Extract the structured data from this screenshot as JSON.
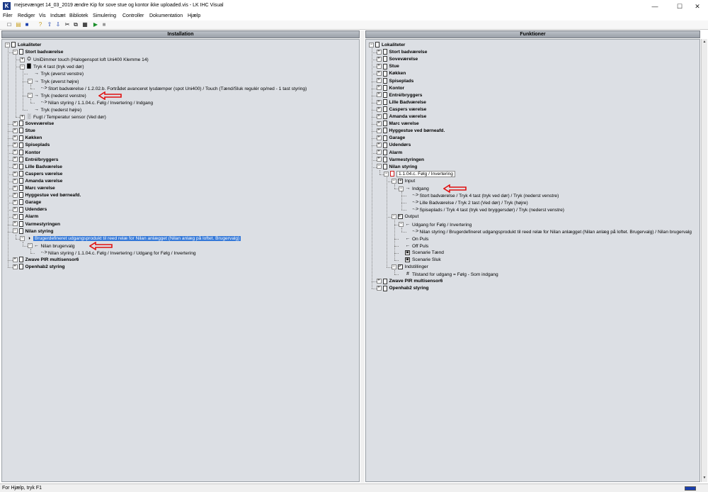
{
  "window": {
    "title": "mejsevænget 14_03_2019 ændre Kip for sove stue og kontor ikke uploaded.vis - LK IHC Visual",
    "controls": {
      "minimize": "—",
      "maximize": "☐",
      "close": "✕"
    }
  },
  "menu": [
    {
      "label": "Filer"
    },
    {
      "label": "Rediger"
    },
    {
      "label": "Vis"
    },
    {
      "label": "Indsæt"
    },
    {
      "label": "Bibliotek"
    },
    {
      "label": "Simulering"
    },
    {
      "label": "Controller"
    },
    {
      "label": "Dokumentation"
    },
    {
      "label": "Hjælp"
    }
  ],
  "toolbar": [
    "new-icon",
    "open-icon",
    "save-icon",
    "help-icon",
    "upload-icon",
    "download-icon",
    "cut-icon",
    "copy-icon",
    "paste-icon",
    "run-icon",
    "stop-icon"
  ],
  "left_pane": {
    "header": "Installation",
    "rows": [
      {
        "label": "Lokaliteter",
        "bold": true,
        "icon": "doc"
      },
      {
        "label": "Stort badværelse",
        "bold": true,
        "icon": "doc"
      },
      {
        "label": "UniDimmer touch (Halogenspot loft  Uni400 Klemme 14)",
        "icon": "dimmer"
      },
      {
        "label": "Tryk 4 tast (tryk ved dør)",
        "icon": "switch"
      },
      {
        "label": "Tryk (øverst venstre)",
        "icon": "arrow"
      },
      {
        "label": "Tryk (øverst højre)",
        "icon": "arrow"
      },
      {
        "label": "Stort badværelse / 1.2.02.b. Fortrådet avanceret lysdæmper (spot Uni400) / Touch (Tænd/Sluk regulér op/ned - 1 tast styring)",
        "icon": "link"
      },
      {
        "label": "Tryk (nederst venstre)",
        "icon": "arrow"
      },
      {
        "label": "Nilan styring / 1.1.04.c. Følg / Invertering  / Indgang",
        "icon": "link"
      },
      {
        "label": "Tryk (nederst højre)",
        "icon": "arrow"
      },
      {
        "label": "Fugt / Temperatur sensor (Ved dør)",
        "icon": "sensor"
      },
      {
        "label": "Soveværelse",
        "bold": true,
        "icon": "doc"
      },
      {
        "label": "Stue",
        "bold": true,
        "icon": "doc"
      },
      {
        "label": "Køkken",
        "bold": true,
        "icon": "doc"
      },
      {
        "label": "Spiseplads",
        "bold": true,
        "icon": "doc"
      },
      {
        "label": "Kontor",
        "bold": true,
        "icon": "doc"
      },
      {
        "label": "Entré/bryggers",
        "bold": true,
        "icon": "doc"
      },
      {
        "label": "Lille Badværelse",
        "bold": true,
        "icon": "doc"
      },
      {
        "label": "Caspers værelse",
        "bold": true,
        "icon": "doc"
      },
      {
        "label": "Amanda værelse",
        "bold": true,
        "icon": "doc"
      },
      {
        "label": "Marc værelse",
        "bold": true,
        "icon": "doc"
      },
      {
        "label": "Hyggestue ved børneafd.",
        "bold": true,
        "icon": "doc"
      },
      {
        "label": "Garage",
        "bold": true,
        "icon": "doc"
      },
      {
        "label": "Udendørs",
        "bold": true,
        "icon": "doc"
      },
      {
        "label": "Alarm",
        "bold": true,
        "icon": "doc"
      },
      {
        "label": "Varmestyringen",
        "bold": true,
        "icon": "doc"
      },
      {
        "label": "Nilan styring",
        "bold": true,
        "icon": "doc"
      },
      {
        "label": "Brugerdefineret udgangsprodukt til reed relæ for Nilan anlægget (Nilan anlæg på loftet. Brugervalg)",
        "icon": "relay",
        "selected": true
      },
      {
        "label": "Nilan brugervalg",
        "icon": "arrow-left"
      },
      {
        "label": "Nilan styring / 1.1.04.c. Følg / Invertering  / Udgang for Følg / Invertering",
        "icon": "link"
      },
      {
        "label": "Zwave PIR multisensor6",
        "bold": true,
        "icon": "doc"
      },
      {
        "label": "Openhab2 styring",
        "bold": true,
        "icon": "doc"
      }
    ]
  },
  "right_pane": {
    "header": "Funktioner",
    "rows": [
      {
        "label": "Lokaliteter",
        "bold": true,
        "icon": "doc"
      },
      {
        "label": "Stort badværelse",
        "bold": true,
        "icon": "doc"
      },
      {
        "label": "Soveværelse",
        "bold": true,
        "icon": "doc"
      },
      {
        "label": "Stue",
        "bold": true,
        "icon": "doc"
      },
      {
        "label": "Køkken",
        "bold": true,
        "icon": "doc"
      },
      {
        "label": "Spiseplads",
        "bold": true,
        "icon": "doc"
      },
      {
        "label": "Kontor",
        "bold": true,
        "icon": "doc"
      },
      {
        "label": "Entré/bryggers",
        "bold": true,
        "icon": "doc"
      },
      {
        "label": "Lille Badværelse",
        "bold": true,
        "icon": "doc"
      },
      {
        "label": "Caspers værelse",
        "bold": true,
        "icon": "doc"
      },
      {
        "label": "Amanda værelse",
        "bold": true,
        "icon": "doc"
      },
      {
        "label": "Marc værelse",
        "bold": true,
        "icon": "doc"
      },
      {
        "label": "Hyggestue ved børneafd.",
        "bold": true,
        "icon": "doc"
      },
      {
        "label": "Garage",
        "bold": true,
        "icon": "doc"
      },
      {
        "label": "Udendørs",
        "bold": true,
        "icon": "doc"
      },
      {
        "label": "Alarm",
        "bold": true,
        "icon": "doc"
      },
      {
        "label": "Varmestyringen",
        "bold": true,
        "icon": "doc"
      },
      {
        "label": "Nilan styring",
        "bold": true,
        "icon": "doc"
      },
      {
        "label": "1.1.04.c. Følg / Invertering",
        "icon": "func",
        "boxed": true
      },
      {
        "label": "Input",
        "icon": "input"
      },
      {
        "label": "Indgang",
        "icon": "arrow"
      },
      {
        "label": "Stort badværelse / Tryk 4 tast (tryk ved dør) / Tryk (nederst venstre)",
        "icon": "link"
      },
      {
        "label": "Lille Badværelse / Tryk 2 tast (Ved dør)  / Tryk (højre)",
        "icon": "link"
      },
      {
        "label": "Spiseplads / Tryk 4 tast (tryk ved bryggersdør)  / Tryk (nederst venstre)",
        "icon": "link"
      },
      {
        "label": "Output",
        "icon": "output"
      },
      {
        "label": "Udgang for Følg / Invertering",
        "icon": "arrow-left"
      },
      {
        "label": "Nilan styring / Brugerdefineret udgangsprodukt til reed relæ for Nilan anlægget (Nilan anlæg på loftet. Brugervalg)  / Nilan brugervalg",
        "icon": "link"
      },
      {
        "label": "On Puls",
        "icon": "arrow-left"
      },
      {
        "label": "Off Puls",
        "icon": "arrow-left"
      },
      {
        "label": "Scenarie Tænd",
        "icon": "scene"
      },
      {
        "label": "Scenarie Sluk",
        "icon": "scene"
      },
      {
        "label": "Indstillinger",
        "icon": "settings"
      },
      {
        "label": "Tilstand for udgang = Følg - Som indgang",
        "icon": "hash"
      },
      {
        "label": "Zwave PIR multisensor6",
        "bold": true,
        "icon": "doc"
      },
      {
        "label": "Openhab2 styring",
        "bold": true,
        "icon": "doc"
      }
    ]
  },
  "status": {
    "text": "For Hjælp, tryk F1"
  }
}
